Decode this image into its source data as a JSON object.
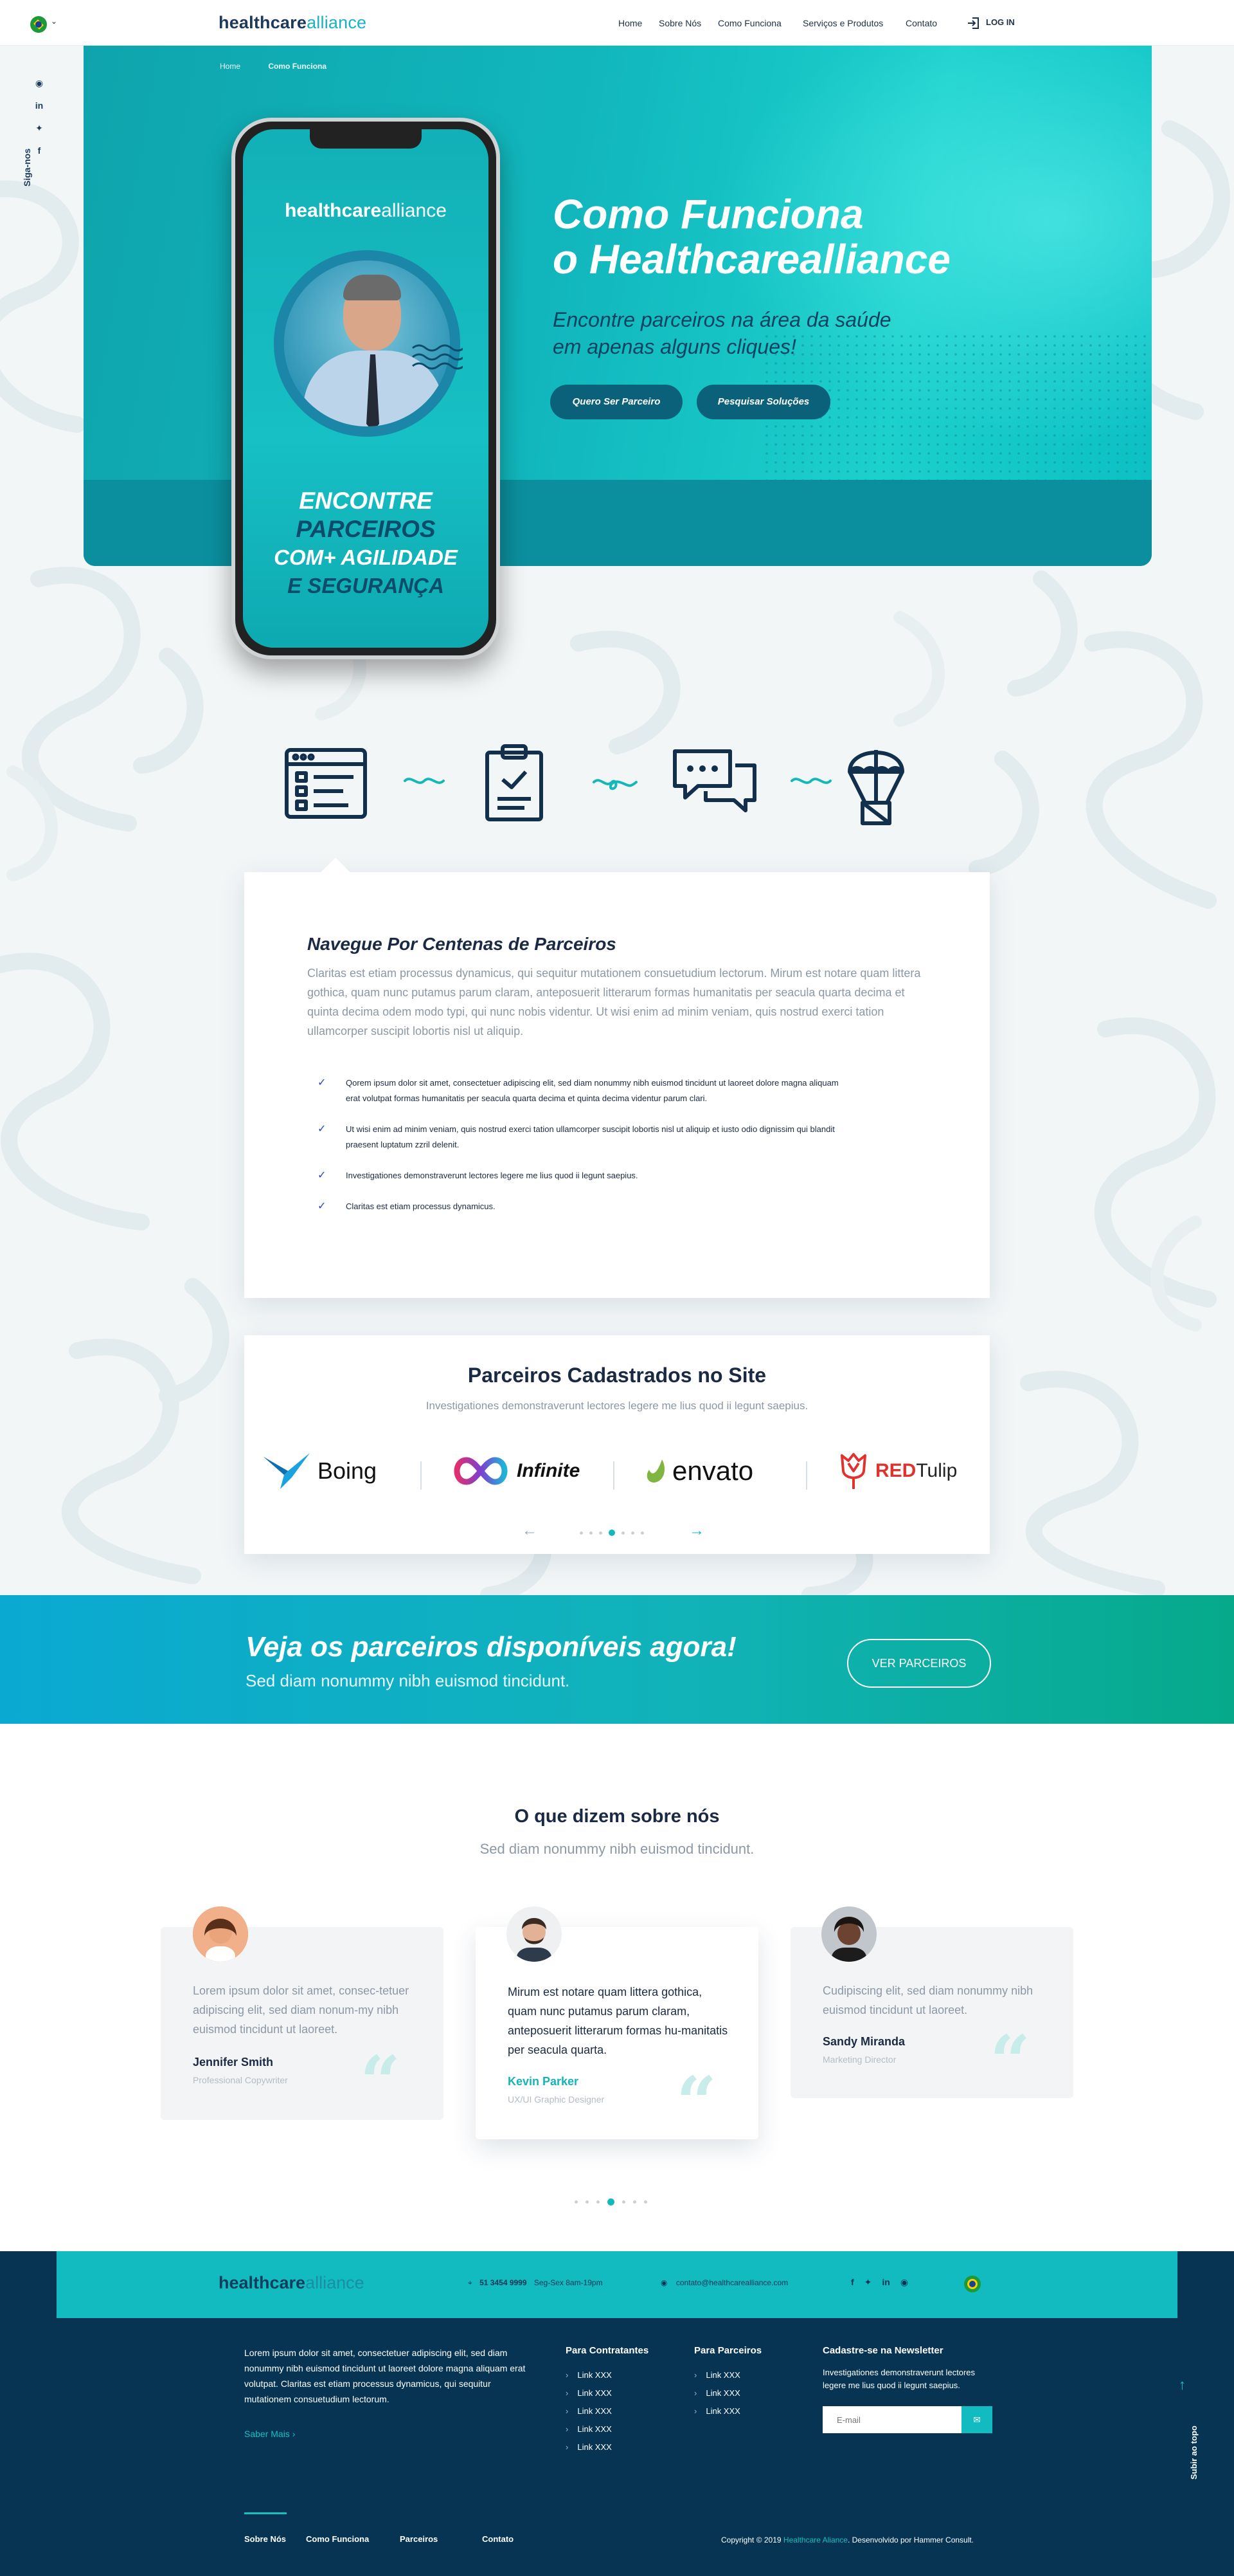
{
  "header": {
    "logo": {
      "part1": "healthcare",
      "part2": "alliance"
    },
    "nav": [
      "Home",
      "Sobre Nós",
      "Como Funciona",
      "Serviços e Produtos",
      "Contato"
    ],
    "login": "LOG IN"
  },
  "social_rail": {
    "label": "Siga-nos",
    "icons": [
      "rss-icon",
      "linkedin-icon",
      "twitter-icon",
      "facebook-icon"
    ]
  },
  "breadcrumb": {
    "home": "Home",
    "current": "Como Funciona"
  },
  "hero": {
    "title_line1": "Como Funciona",
    "title_line2": "o Healthcarealliance",
    "subtitle_line1": "Encontre parceiros na área da saúde",
    "subtitle_line2": "em apenas alguns cliques!",
    "button_partner": "Quero Ser Parceiro",
    "button_search": "Pesquisar Soluções"
  },
  "phone": {
    "logo": {
      "part1": "healthcare",
      "part2": "alliance"
    },
    "lines": [
      "ENCONTRE",
      "PARCEIROS",
      "COM+ AGILIDADE",
      "E SEGURANÇA"
    ]
  },
  "steps": [
    "browser-list-icon",
    "clipboard-check-icon",
    "chat-bubbles-icon",
    "parachute-box-icon"
  ],
  "navigate": {
    "title": "Navegue Por Centenas de Parceiros",
    "paragraph": "Claritas est etiam processus dynamicus, qui sequitur mutationem consuetudium lectorum. Mirum est notare quam littera gothica, quam nunc putamus parum claram, anteposuerit litterarum formas humanitatis per seacula quarta decima et quinta decima odem modo typi, qui nunc nobis videntur. Ut wisi enim ad minim veniam, quis nostrud exerci tation ullamcorper suscipit lobortis nisl ut aliquip.",
    "items": [
      "Qorem ipsum dolor sit amet, consectetuer adipiscing elit, sed diam nonummy nibh euismod tincidunt ut laoreet dolore magna aliquam erat volutpat formas humanitatis per seacula quarta decima et quinta decima videntur parum clari.",
      "Ut wisi enim ad minim veniam, quis nostrud exerci tation ullamcorper suscipit lobortis nisl ut aliquip et iusto odio dignissim qui blandit praesent luptatum zzril delenit.",
      "Investigationes demonstraverunt lectores legere me lius quod ii legunt saepius.",
      "Claritas est etiam processus dynamicus."
    ]
  },
  "partners": {
    "title": "Parceiros Cadastrados no Site",
    "subtitle": "Investigationes demonstraverunt lectores legere me lius quod ii legunt saepius.",
    "brands": {
      "boing": "Boing",
      "infinite": "Infinite",
      "envato": "envato",
      "redtulip_red": "RED",
      "redtulip_dark": "Tulip"
    }
  },
  "cta": {
    "title": "Veja os parceiros disponíveis agora!",
    "subtitle": "Sed diam nonummy nibh euismod tincidunt.",
    "button": "VER PARCEIROS"
  },
  "testimonials": {
    "title": "O que dizem sobre nós",
    "subtitle": "Sed diam nonummy nibh euismod tincidunt.",
    "items": [
      {
        "quote": "Lorem ipsum dolor sit amet, consec-tetuer adipiscing elit, sed diam nonum-my nibh euismod tincidunt ut laoreet.",
        "name": "Jennifer Smith",
        "role": "Professional Copywriter"
      },
      {
        "quote": "Mirum est notare quam littera gothica, quam nunc putamus parum claram, anteposuerit litterarum formas hu-manitatis per seacula quarta.",
        "name": "Kevin Parker",
        "role": "UX/UI Graphic Designer"
      },
      {
        "quote": "Cudipiscing elit, sed diam nonummy nibh euismod tincidunt ut laoreet.",
        "name": "Sandy Miranda",
        "role": "Marketing Director"
      }
    ]
  },
  "footer": {
    "logo": {
      "part1": "healthcare",
      "part2": "alliance"
    },
    "phone_number": "51 3454 9999",
    "hours": "Seg-Sex 8am-19pm",
    "email": "contato@healthcarealliance.com",
    "about": "Lorem ipsum dolor sit amet, consectetuer adipiscing elit, sed diam nonummy nibh euismod tincidunt ut laoreet dolore magna aliquam erat volutpat. Claritas est etiam processus dynamicus, qui sequitur mutationem consuetudium lectorum.",
    "more_link": "Saber Mais",
    "col_contratantes": {
      "title": "Para Contratantes",
      "links": [
        "Link XXX",
        "Link XXX",
        "Link XXX",
        "Link XXX",
        "Link XXX"
      ]
    },
    "col_parceiros": {
      "title": "Para Parceiros",
      "links": [
        "Link XXX",
        "Link XXX",
        "Link XXX"
      ]
    },
    "newsletter": {
      "title": "Cadastre-se na Newsletter",
      "text": "Investigationes demonstraverunt lectores legere me lius quod ii legunt saepius.",
      "placeholder": "E-mail"
    },
    "back_to_top": "Subir ao topo",
    "bottom_links": [
      "Sobre Nós",
      "Como Funciona",
      "Parceiros",
      "Contato"
    ],
    "copyright_pre": "Copyright © 2019",
    "copyright_brand": "Healthcare Aliance",
    "copyright_post": ". Desenvolvido por Hammer Consult."
  },
  "colors": {
    "primary": "#11bbc0",
    "navy": "#063452",
    "accent_blue": "#1d49c4"
  }
}
